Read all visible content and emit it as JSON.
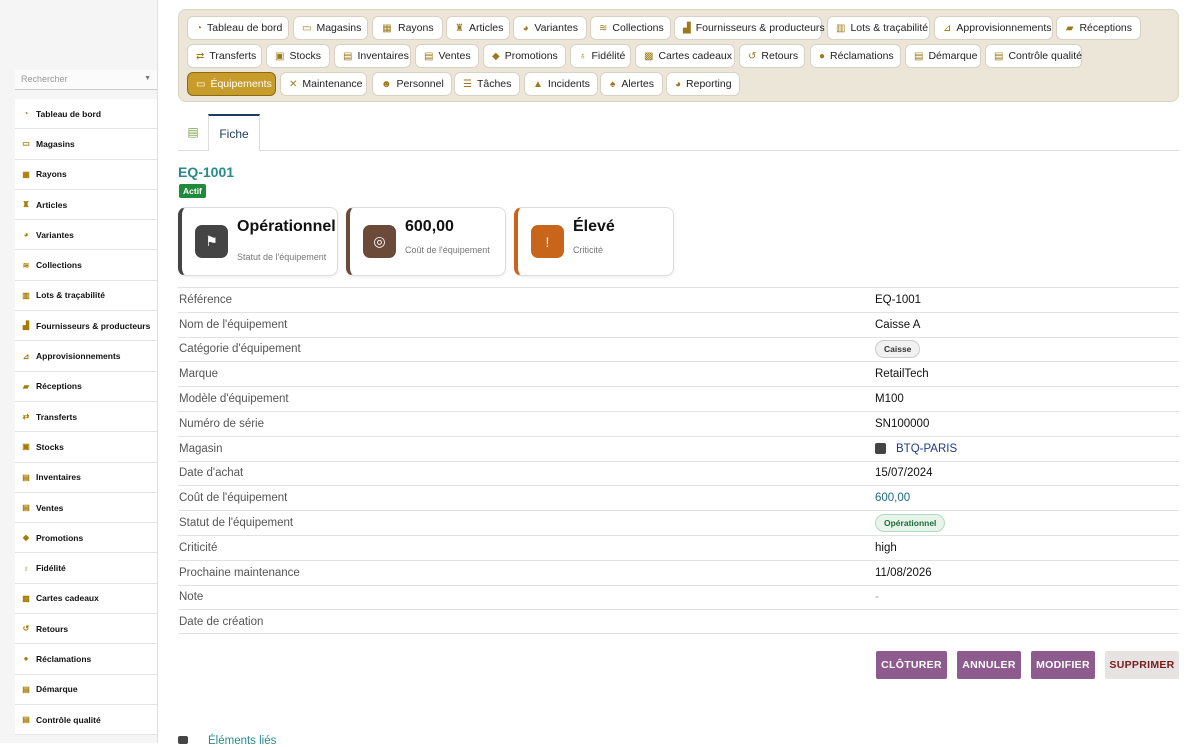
{
  "sidebar": {
    "search_placeholder": "Rechercher",
    "items": [
      {
        "label": "Tableau de bord",
        "icon": "dashboard-icon"
      },
      {
        "label": "Magasins",
        "icon": "store-icon"
      },
      {
        "label": "Rayons",
        "icon": "grid-icon"
      },
      {
        "label": "Articles",
        "icon": "shirt-icon"
      },
      {
        "label": "Variantes",
        "icon": "palette-icon"
      },
      {
        "label": "Collections",
        "icon": "layers-icon"
      },
      {
        "label": "Lots & traçabilité",
        "icon": "barcode-icon"
      },
      {
        "label": "Fournisseurs & producteurs",
        "icon": "industry-icon"
      },
      {
        "label": "Approvisionnements",
        "icon": "dolly-icon"
      },
      {
        "label": "Réceptions",
        "icon": "truck-icon"
      },
      {
        "label": "Transferts",
        "icon": "exchange-icon"
      },
      {
        "label": "Stocks",
        "icon": "box-icon"
      },
      {
        "label": "Inventaires",
        "icon": "clipboard-icon"
      },
      {
        "label": "Ventes",
        "icon": "cash-register-icon"
      },
      {
        "label": "Promotions",
        "icon": "tags-icon"
      },
      {
        "label": "Fidélité",
        "icon": "award-icon"
      },
      {
        "label": "Cartes cadeaux",
        "icon": "gift-icon"
      },
      {
        "label": "Retours",
        "icon": "undo-icon"
      },
      {
        "label": "Réclamations",
        "icon": "comment-icon"
      },
      {
        "label": "Démarque",
        "icon": "file-icon"
      },
      {
        "label": "Contrôle qualité",
        "icon": "clipboard-check-icon"
      }
    ]
  },
  "topnav": {
    "items": [
      {
        "label": "Tableau de bord",
        "icon": "dashboard-icon",
        "active": false
      },
      {
        "label": "Magasins",
        "icon": "store-icon",
        "active": false
      },
      {
        "label": "Rayons",
        "icon": "grid-icon",
        "active": false
      },
      {
        "label": "Articles",
        "icon": "shirt-icon",
        "active": false
      },
      {
        "label": "Variantes",
        "icon": "palette-icon",
        "active": false
      },
      {
        "label": "Collections",
        "icon": "layers-icon",
        "active": false
      },
      {
        "label": "Fournisseurs & producteurs",
        "icon": "industry-icon",
        "active": false
      },
      {
        "label": "Lots & traçabilité",
        "icon": "barcode-icon",
        "active": false
      },
      {
        "label": "Approvisionnements",
        "icon": "dolly-icon",
        "active": false
      },
      {
        "label": "Réceptions",
        "icon": "truck-icon",
        "active": false
      },
      {
        "label": "Transferts",
        "icon": "exchange-icon",
        "active": false
      },
      {
        "label": "Stocks",
        "icon": "box-icon",
        "active": false
      },
      {
        "label": "Inventaires",
        "icon": "clipboard-icon",
        "active": false
      },
      {
        "label": "Ventes",
        "icon": "cash-register-icon",
        "active": false
      },
      {
        "label": "Promotions",
        "icon": "tags-icon",
        "active": false
      },
      {
        "label": "Fidélité",
        "icon": "award-icon",
        "active": false
      },
      {
        "label": "Cartes cadeaux",
        "icon": "gift-icon",
        "active": false
      },
      {
        "label": "Retours",
        "icon": "undo-icon",
        "active": false
      },
      {
        "label": "Réclamations",
        "icon": "comment-icon",
        "active": false
      },
      {
        "label": "Démarque",
        "icon": "file-icon",
        "active": false
      },
      {
        "label": "Contrôle qualité",
        "icon": "clipboard-check-icon",
        "active": false
      },
      {
        "label": "Équipements",
        "icon": "desktop-icon",
        "active": true
      },
      {
        "label": "Maintenance",
        "icon": "tools-icon",
        "active": false
      },
      {
        "label": "Personnel",
        "icon": "users-icon",
        "active": false
      },
      {
        "label": "Tâches",
        "icon": "list-icon",
        "active": false
      },
      {
        "label": "Incidents",
        "icon": "warning-icon",
        "active": false
      },
      {
        "label": "Alertes",
        "icon": "bell-icon",
        "active": false
      },
      {
        "label": "Reporting",
        "icon": "chart-pie-icon",
        "active": false
      }
    ]
  },
  "tabs": {
    "fiche": "Fiche",
    "icon": "cash-register-icon"
  },
  "record": {
    "title": "EQ-1001",
    "status_badge": "Actif"
  },
  "kpis": [
    {
      "value": "Opérationnel",
      "label": "Statut de l'équipement",
      "icon": "flag-icon",
      "color": "#444444"
    },
    {
      "value": "600,00",
      "label": "Coût de l'équipement",
      "icon": "coins-icon",
      "color": "#6b4a3a"
    },
    {
      "value": "Élevé",
      "label": "Criticité",
      "icon": "exclamation-icon",
      "color": "#c8651a"
    }
  ],
  "details": [
    {
      "label": "Référence",
      "value": "EQ-1001",
      "type": "text"
    },
    {
      "label": "Nom de l'équipement",
      "value": "Caisse A",
      "type": "text"
    },
    {
      "label": "Catégorie d'équipement",
      "value": "Caisse",
      "type": "pill"
    },
    {
      "label": "Marque",
      "value": "RetailTech",
      "type": "text"
    },
    {
      "label": "Modèle d'équipement",
      "value": "M100",
      "type": "text"
    },
    {
      "label": "Numéro de série",
      "value": "SN100000",
      "type": "text"
    },
    {
      "label": "Magasin",
      "value": "BTQ-PARIS",
      "type": "link"
    },
    {
      "label": "Date d'achat",
      "value": "15/07/2024",
      "type": "text"
    },
    {
      "label": "Coût de l'équipement",
      "value": "600,00",
      "type": "money"
    },
    {
      "label": "Statut de l'équipement",
      "value": "Opérationnel",
      "type": "pill-green"
    },
    {
      "label": "Criticité",
      "value": "high",
      "type": "text"
    },
    {
      "label": "Prochaine maintenance",
      "value": "11/08/2026",
      "type": "text"
    },
    {
      "label": "Note",
      "value": "-",
      "type": "dash"
    },
    {
      "label": "Date de création",
      "value": "",
      "type": "text"
    }
  ],
  "actions": {
    "close": "CLÔTURER",
    "cancel": "ANNULER",
    "edit": "MODIFIER",
    "delete": "SUPPRIMER"
  },
  "related": {
    "label": "Éléments liés"
  }
}
